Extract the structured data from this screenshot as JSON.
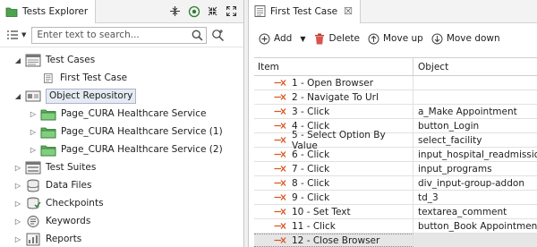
{
  "left_panel": {
    "tab_title": "Tests Explorer",
    "search": {
      "placeholder": "Enter text to search..."
    },
    "tree": [
      {
        "label": "Test Cases",
        "expanded": true,
        "icon": "test-cases-folder-icon"
      },
      {
        "label": "First Test Case",
        "icon": "test-case-icon"
      },
      {
        "label": "Object Repository",
        "expanded": true,
        "selected": true,
        "icon": "object-repository-icon"
      },
      {
        "label": "Page_CURA Healthcare Service",
        "icon": "page-folder-icon"
      },
      {
        "label": "Page_CURA Healthcare Service (1)",
        "icon": "page-folder-icon"
      },
      {
        "label": "Page_CURA Healthcare Service (2)",
        "icon": "page-folder-icon"
      },
      {
        "label": "Test Suites",
        "icon": "test-suites-icon"
      },
      {
        "label": "Data Files",
        "icon": "data-files-icon"
      },
      {
        "label": "Checkpoints",
        "icon": "checkpoints-icon"
      },
      {
        "label": "Keywords",
        "icon": "keywords-icon"
      },
      {
        "label": "Reports",
        "icon": "reports-icon"
      }
    ]
  },
  "right_panel": {
    "tab_title": "First Test Case",
    "toolbar": {
      "add_label": "Add",
      "delete_label": "Delete",
      "move_up_label": "Move up",
      "move_down_label": "Move down"
    },
    "columns": {
      "item": "Item",
      "object": "Object"
    },
    "rows": [
      {
        "item": "1 - Open Browser",
        "object": ""
      },
      {
        "item": "2 - Navigate To Url",
        "object": ""
      },
      {
        "item": "3 - Click",
        "object": "a_Make Appointment"
      },
      {
        "item": "4 - Click",
        "object": "button_Login"
      },
      {
        "item": "5 - Select Option By Value",
        "object": "select_facility"
      },
      {
        "item": "6 - Click",
        "object": "input_hospital_readmission"
      },
      {
        "item": "7 - Click",
        "object": "input_programs"
      },
      {
        "item": "8 - Click",
        "object": "div_input-group-addon"
      },
      {
        "item": "9 - Click",
        "object": "td_3"
      },
      {
        "item": "10 - Set Text",
        "object": "textarea_comment"
      },
      {
        "item": "11 - Click",
        "object": "button_Book Appointment"
      },
      {
        "item": "12 - Close Browser",
        "object": "",
        "selected": true
      }
    ]
  },
  "colors": {
    "step_icon": "#d9531e",
    "folder_green": "#3c9a3c",
    "selection_bg": "#e6e6e6",
    "tree_selection_bg": "#e6ebf3"
  }
}
